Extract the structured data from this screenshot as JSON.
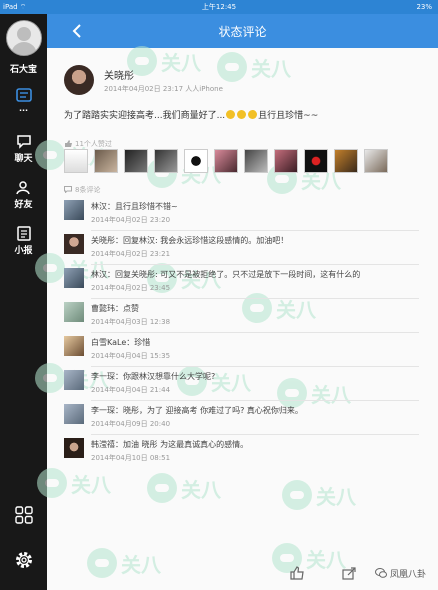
{
  "status_bar": {
    "left": "iPad ⌔",
    "time": "上午12:45",
    "battery": "23%"
  },
  "sidebar": {
    "user_name": "石大宝",
    "dots": "...",
    "items": [
      {
        "label": "聊天",
        "icon": "chat-icon"
      },
      {
        "label": "好友",
        "icon": "friends-icon"
      },
      {
        "label": "小报",
        "icon": "news-icon"
      }
    ],
    "bottom_icons": [
      "apps-grid-icon",
      "settings-gear-icon"
    ]
  },
  "header": {
    "title": "状态评论",
    "back_icon": "back-chevron-icon"
  },
  "post": {
    "author": "关晓彤",
    "meta": "2014年04月02日 23:17  人人iPhone",
    "text_before": "为了踏踏实实迎接高考...我们商量好了...",
    "text_after": "且行且珍惜~~",
    "emoji_count": 3
  },
  "likes": {
    "label": "11个人赞过"
  },
  "comments_section": {
    "label": "8条评论"
  },
  "comments": [
    {
      "text": "林汉：且行且珍惜不错~",
      "time": "2014年04月02日 23:20"
    },
    {
      "text": "关晓彤：回复林汉: 我会永远珍惜这段感情的。加油吧！",
      "time": "2014年04月02日 23:21"
    },
    {
      "text": "林汉：回复关晓彤: 可又不是被拒绝了。只不过是放下一段时间，这有什么的",
      "time": "2014年04月02日 23:45"
    },
    {
      "text": "曹懿玮：点赞",
      "time": "2014年04月03日 12:38"
    },
    {
      "text": "白雪KaLe：珍惜",
      "time": "2014年04月04日 15:35"
    },
    {
      "text": "李一琛：你跟林汉想靠什么大学呢?",
      "time": "2014年04月04日 21:44"
    },
    {
      "text": "李一琛：晓彤，为了 迎接高考 你难过了吗? 真心祝你归来。",
      "time": "2014年04月09日 20:40"
    },
    {
      "text": "韩滢禧：加油 晓彤 为这最真诚真心的感情。",
      "time": "2014年04月10日 08:51"
    }
  ],
  "bottom": {
    "brand": "凤凰八卦"
  },
  "watermark": {
    "text": "关八"
  },
  "colors": {
    "accent": "#3b8ee0",
    "sidebar": "#181818",
    "watermark": "#b5e6cf"
  }
}
